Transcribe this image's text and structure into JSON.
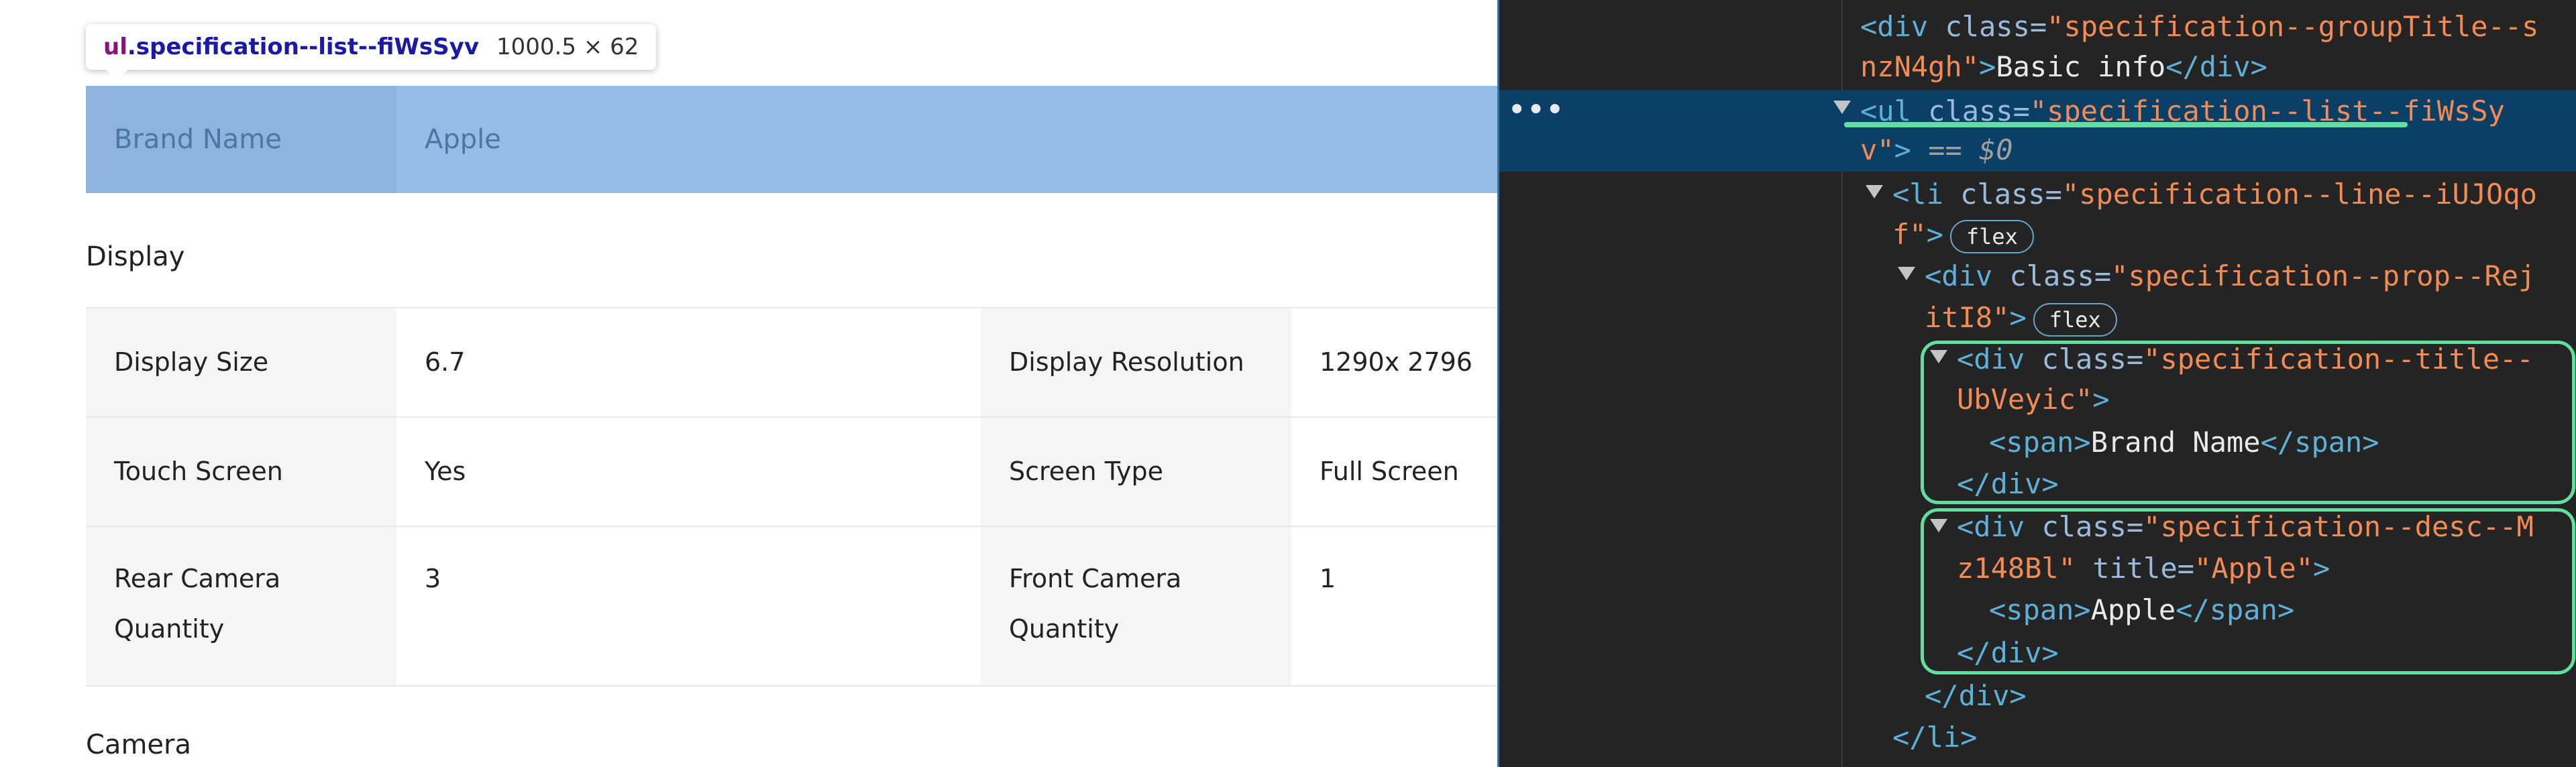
{
  "tooltip": {
    "tag": "ul",
    "class_name": ".specification--list--fiWsSyv",
    "dimensions": "1000.5 × 62"
  },
  "basic_row": {
    "title": "Brand Name",
    "desc": "Apple"
  },
  "groups": {
    "display": "Display",
    "camera": "Camera"
  },
  "display_rows": [
    {
      "t1": "Display Size",
      "d1": "6.7",
      "t2": "Display Resolution",
      "d2": "1290x 2796"
    },
    {
      "t1": "Touch Screen",
      "d1": "Yes",
      "t2": "Screen Type",
      "d2": "Full Screen"
    },
    {
      "t1a": "Rear Camera",
      "t1b": "Quantity",
      "d1": "3",
      "t2a": "Front Camera",
      "t2b": "Quantity",
      "d2": "1"
    }
  ],
  "devtools": {
    "ellipsis": "•••",
    "l1": {
      "tag_open": "<div ",
      "attr": "class=",
      "val": "\"specification--groupTitle--s"
    },
    "l2": {
      "val": "nzN4gh\"",
      "close": ">",
      "text": "Basic info",
      "end": "</div>"
    },
    "l3": {
      "tag_open": "<ul ",
      "attr": "class=",
      "val": "\"specification--list--fiWsSy"
    },
    "l4": {
      "val": "v\"",
      "close": ">",
      "eq": " == $0"
    },
    "l5": {
      "tag_open": "<li ",
      "attr": "class=",
      "val": "\"specification--line--iUJOqo"
    },
    "l6": {
      "val": "f\"",
      "close": ">",
      "badge": "flex"
    },
    "l7": {
      "tag_open": "<div ",
      "attr": "class=",
      "val": "\"specification--prop--Rej"
    },
    "l8": {
      "val": "itI8\"",
      "close": ">",
      "badge": "flex"
    },
    "l9": {
      "tag_open": "<div ",
      "attr": "class=",
      "val": "\"specification--title--"
    },
    "l10": {
      "val": "UbVeyic\"",
      "close": ">"
    },
    "l11": {
      "open": "<span>",
      "text": "Brand Name",
      "close": "</span>"
    },
    "l12": {
      "end": "</div>"
    },
    "l13": {
      "tag_open": "<div ",
      "attr": "class=",
      "val": "\"specification--desc--M"
    },
    "l14": {
      "val": "z148Bl\"",
      "attr": " title=",
      "val2": "\"Apple\"",
      "close": ">"
    },
    "l15": {
      "open": "<span>",
      "text": "Apple",
      "close": "</span>"
    },
    "l16": {
      "end": "</div>"
    },
    "l17": {
      "end": "</div>"
    },
    "l18": {
      "end": "</li>"
    }
  }
}
